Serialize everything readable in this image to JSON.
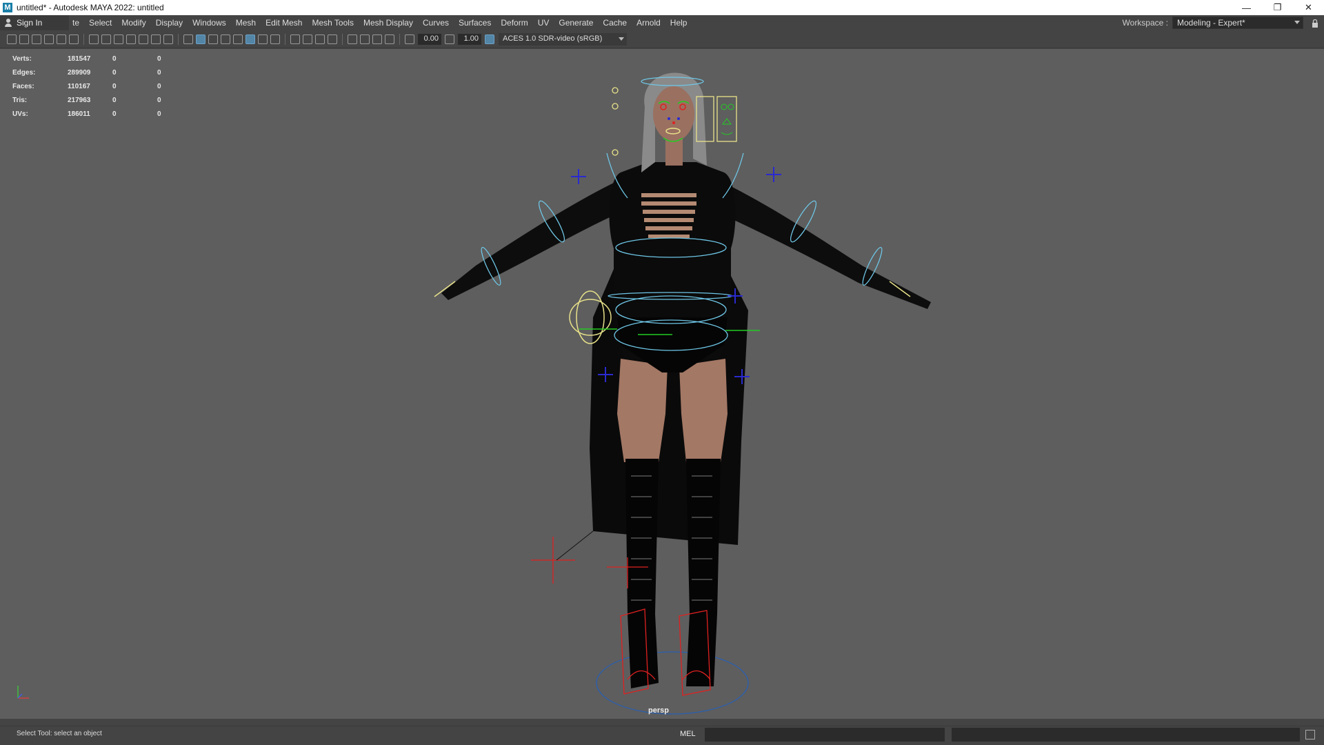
{
  "window": {
    "title": "untitled* - Autodesk MAYA 2022: untitled",
    "app_icon": "M",
    "buttons": [
      "minimize-icon",
      "restore-icon",
      "close-icon"
    ]
  },
  "menubar": {
    "sign_in": "Sign In",
    "items": [
      "te",
      "Select",
      "Modify",
      "Display",
      "Windows",
      "Mesh",
      "Edit Mesh",
      "Mesh Tools",
      "Mesh Display",
      "Curves",
      "Surfaces",
      "Deform",
      "UV",
      "Generate",
      "Cache",
      "Arnold",
      "Help"
    ],
    "workspace_label": "Workspace :",
    "workspace_value": "Modeling - Expert*"
  },
  "toolbar": {
    "exposure": "0.00",
    "gamma": "1.00",
    "color_management": "ACES 1.0 SDR-video (sRGB)"
  },
  "hud": {
    "rows": [
      {
        "label": "Verts:",
        "value": "181547",
        "a": "0",
        "b": "0"
      },
      {
        "label": "Edges:",
        "value": "289909",
        "a": "0",
        "b": "0"
      },
      {
        "label": "Faces:",
        "value": "110167",
        "a": "0",
        "b": "0"
      },
      {
        "label": "Tris:",
        "value": "217963",
        "a": "0",
        "b": "0"
      },
      {
        "label": "UVs:",
        "value": "186011",
        "a": "0",
        "b": "0"
      }
    ]
  },
  "viewport": {
    "camera": "persp",
    "background": "#5e5e5e"
  },
  "status": {
    "help_line": "Select Tool: select an object",
    "command_lang": "MEL"
  },
  "colors": {
    "accent": "#5285a6",
    "ctrl_cyan": "#6ec6e6",
    "ctrl_yellow": "#e8e28a",
    "ctrl_blue": "#2a2ad0",
    "ctrl_red": "#e02020",
    "ctrl_green": "#22cc22"
  }
}
